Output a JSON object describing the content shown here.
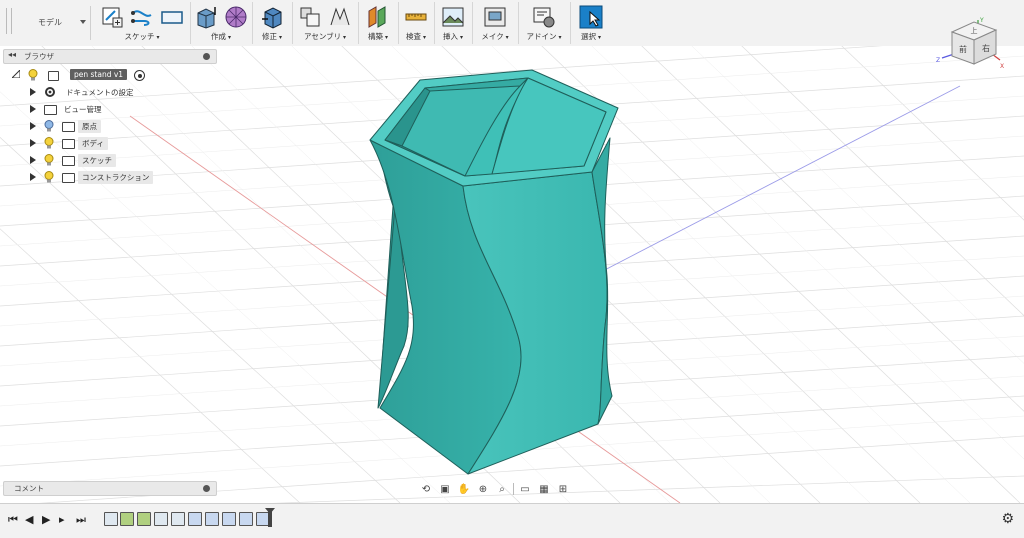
{
  "toolbar": {
    "workspace_label": "モデル",
    "groups": [
      {
        "label": "スケッチ"
      },
      {
        "label": "作成"
      },
      {
        "label": "修正"
      },
      {
        "label": "アセンブリ"
      },
      {
        "label": "構築"
      },
      {
        "label": "検査"
      },
      {
        "label": "挿入"
      },
      {
        "label": "メイク"
      },
      {
        "label": "アドイン"
      },
      {
        "label": "選択"
      }
    ]
  },
  "browser": {
    "title": "ブラウザ",
    "root_label": "pen stand v1",
    "items": [
      {
        "label": "ドキュメントの設定",
        "icon": "gear-icon"
      },
      {
        "label": "ビュー管理",
        "icon": "folder-icon"
      },
      {
        "label": "原点",
        "icon": "folder-icon"
      },
      {
        "label": "ボディ",
        "icon": "folder-icon"
      },
      {
        "label": "スケッチ",
        "icon": "folder-icon"
      },
      {
        "label": "コンストラクション",
        "icon": "folder-icon"
      }
    ]
  },
  "comments": {
    "title": "コメント"
  },
  "viewcube": {
    "top_label": "上",
    "front_label": "前",
    "right_label": "右",
    "axis_x": "X",
    "axis_y": "Y",
    "axis_z": "Z"
  },
  "colors": {
    "model": "#3fbfb7",
    "model_dark": "#2a9d96",
    "accent": "#1a80c8"
  }
}
